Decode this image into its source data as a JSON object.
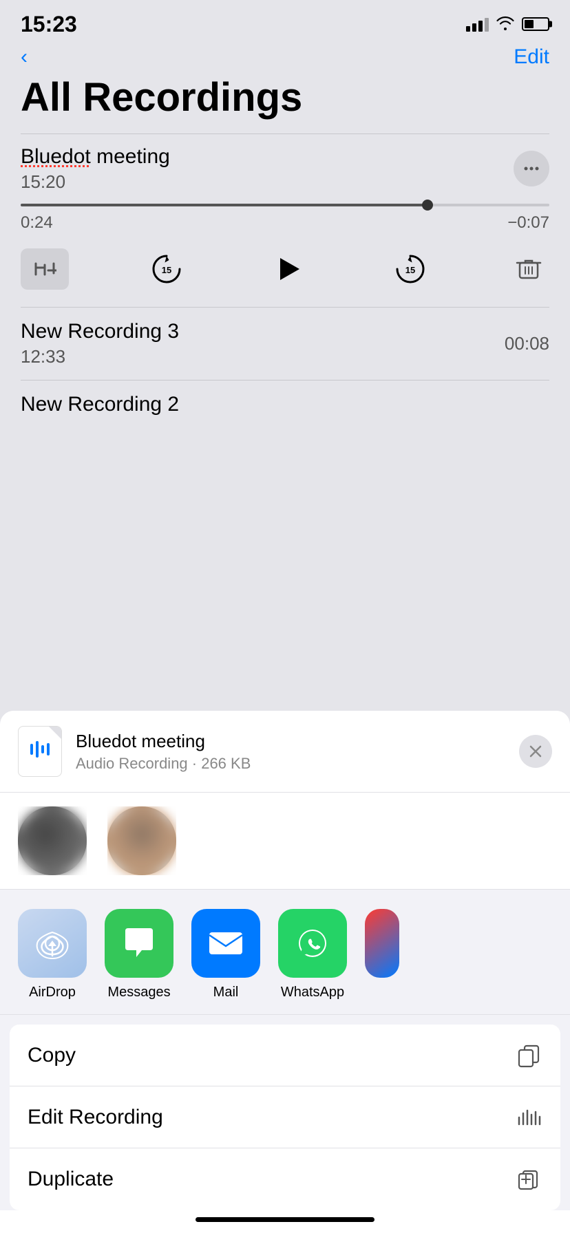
{
  "statusBar": {
    "time": "15:23"
  },
  "nav": {
    "backLabel": "‹",
    "editLabel": "Edit"
  },
  "page": {
    "title": "All Recordings"
  },
  "recordings": [
    {
      "name": "Bluedot meeting",
      "nameUnderline": "Bluedot",
      "time": "15:20",
      "progress": "0:24",
      "remaining": "−0:07",
      "progressPercent": 77
    },
    {
      "name": "New Recording 3",
      "time": "12:33",
      "duration": "00:08"
    },
    {
      "name": "New Recording 2",
      "time": ""
    }
  ],
  "shareSheet": {
    "fileName": "Bluedot meeting",
    "fileMeta": "Audio Recording · 266 KB",
    "closeLabel": "×"
  },
  "appIcons": [
    {
      "id": "airdrop",
      "label": "AirDrop"
    },
    {
      "id": "messages",
      "label": "Messages"
    },
    {
      "id": "mail",
      "label": "Mail"
    },
    {
      "id": "whatsapp",
      "label": "WhatsApp"
    }
  ],
  "actions": [
    {
      "id": "copy",
      "label": "Copy"
    },
    {
      "id": "edit-recording",
      "label": "Edit Recording"
    },
    {
      "id": "duplicate",
      "label": "Duplicate"
    }
  ],
  "controls": {
    "skipBack": "15",
    "skipForward": "15"
  }
}
